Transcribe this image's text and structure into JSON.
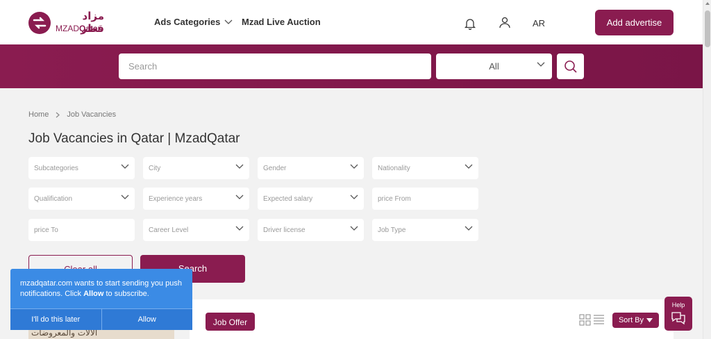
{
  "header": {
    "logo_ar": "مزاد قطر",
    "logo_en_a": "MZAD",
    "logo_en_b": "Qatar",
    "nav_ads": "Ads Categories",
    "nav_live": "Mzad Live Auction",
    "lang": "AR",
    "add_btn": "Add advertise"
  },
  "search": {
    "placeholder": "Search",
    "category": "All"
  },
  "breadcrumb": {
    "home": "Home",
    "current": "Job Vacancies"
  },
  "page_title": "Job Vacancies in Qatar | MzadQatar",
  "filters": [
    {
      "label": "Subcategories",
      "dropdown": true
    },
    {
      "label": "City",
      "dropdown": true
    },
    {
      "label": "Gender",
      "dropdown": true
    },
    {
      "label": "Nationality",
      "dropdown": true
    },
    {
      "label": "Qualification",
      "dropdown": true
    },
    {
      "label": "Experience years",
      "dropdown": true
    },
    {
      "label": "Expected salary",
      "dropdown": true
    },
    {
      "label": "price From",
      "dropdown": false
    },
    {
      "label": "price To",
      "dropdown": false
    },
    {
      "label": "Career Level",
      "dropdown": true
    },
    {
      "label": "Driver license",
      "dropdown": true
    },
    {
      "label": "Job Type",
      "dropdown": true
    }
  ],
  "buttons": {
    "clear": "Clear all",
    "search": "Search"
  },
  "listing": {
    "job_offer": "Job Offer",
    "sort": "Sort By",
    "thumb_text": "الآلات والمعروضات"
  },
  "notification": {
    "text_a": "mzadqatar.com wants to start sending you push notifications. Click ",
    "text_allow": "Allow",
    "text_b": " to subscribe.",
    "later": "I'll do this later",
    "allow": "Allow"
  },
  "help": "Help",
  "colors": {
    "brand": "#8a1c50",
    "notify": "#3b8be5"
  }
}
